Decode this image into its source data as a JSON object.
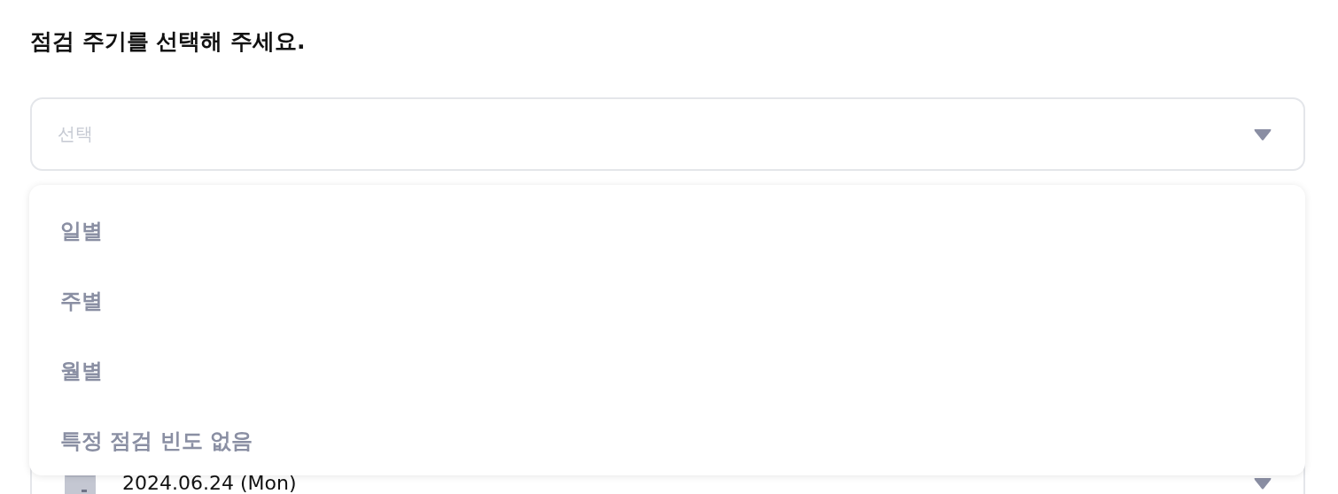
{
  "heading": "점검 주기를 선택해 주세요.",
  "select": {
    "placeholder": "선택",
    "expanded": true,
    "options": [
      {
        "label": "일별",
        "selected": false
      },
      {
        "label": "주별",
        "selected": false
      },
      {
        "label": "월별",
        "selected": false
      },
      {
        "label": "특정 점검 빈도 없음",
        "selected": false
      }
    ]
  },
  "date_field": {
    "value": "2024.06.24 (Mon)"
  }
}
